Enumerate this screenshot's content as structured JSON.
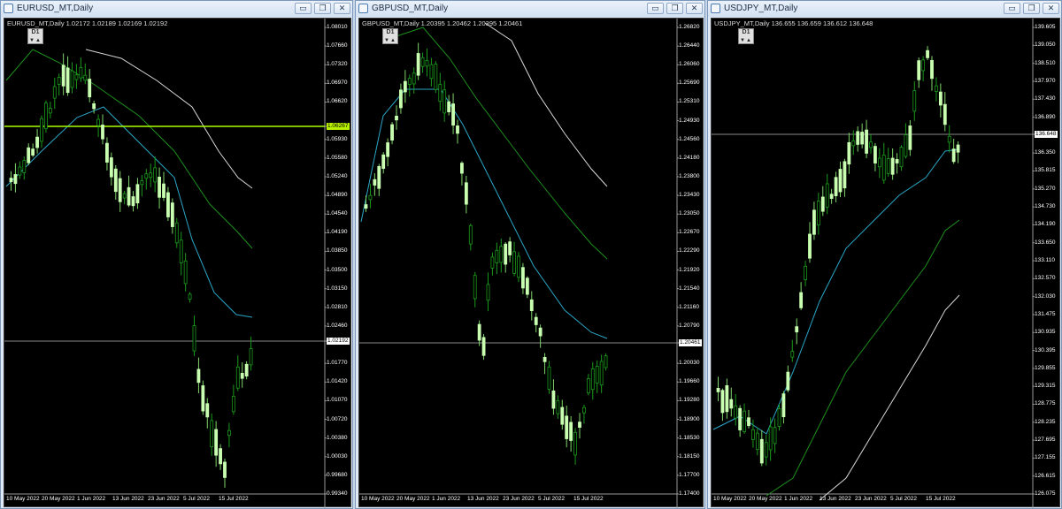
{
  "windows": [
    {
      "title": "EURUSD_MT,Daily",
      "info": "EURUSD_MT,Daily  1.02172 1.02189 1.02169 1.02192",
      "timeframe": "D1",
      "prices": [
        "1.08010",
        "1.07660",
        "1.07320",
        "1.06970",
        "1.06620",
        "1.06267",
        "1.05930",
        "1.05580",
        "1.05240",
        "1.04890",
        "1.04540",
        "1.04190",
        "1.03850",
        "1.03500",
        "1.03150",
        "1.02810",
        "1.02460",
        "1.02192",
        "1.01770",
        "1.01420",
        "1.01070",
        "1.00720",
        "1.00380",
        "1.00030",
        "0.99680",
        "0.99340"
      ],
      "current_price": "1.02192",
      "hline_price": "1.06267",
      "dates": [
        "10 May 2022",
        "20 May 2022",
        "1 Jun 2022",
        "13 Jun 2022",
        "23 Jun 2022",
        "5 Jul 2022",
        "15 Jul 2022"
      ]
    },
    {
      "title": "GBPUSD_MT,Daily",
      "info": "GBPUSD_MT,Daily  1.20395 1.20462 1.20395 1.20461",
      "timeframe": "D1",
      "prices": [
        "1.26820",
        "1.26440",
        "1.26060",
        "1.25690",
        "1.25310",
        "1.24930",
        "1.24560",
        "1.24180",
        "1.23800",
        "1.23430",
        "1.23050",
        "1.22670",
        "1.22290",
        "1.21920",
        "1.21540",
        "1.21160",
        "1.20790",
        "1.20461",
        "1.20030",
        "1.19660",
        "1.19280",
        "1.18900",
        "1.18530",
        "1.18150",
        "1.17700",
        "1.17400"
      ],
      "current_price": "1.20461",
      "dates": [
        "10 May 2022",
        "20 May 2022",
        "1 Jun 2022",
        "13 Jun 2022",
        "23 Jun 2022",
        "5 Jul 2022",
        "15 Jul 2022"
      ]
    },
    {
      "title": "USDJPY_MT,Daily",
      "info": "USDJPY_MT,Daily  136.655 136.659 136.612 136.648",
      "timeframe": "D1",
      "prices": [
        "139.605",
        "139.050",
        "138.510",
        "137.970",
        "137.430",
        "136.890",
        "136.648",
        "136.350",
        "135.815",
        "135.270",
        "134.730",
        "134.190",
        "133.650",
        "133.110",
        "132.570",
        "132.030",
        "131.475",
        "130.935",
        "130.395",
        "129.855",
        "129.315",
        "128.775",
        "128.235",
        "127.695",
        "127.155",
        "126.615",
        "126.075"
      ],
      "current_price": "136.648",
      "dates": [
        "10 May 2022",
        "20 May 2022",
        "1 Jun 2022",
        "13 Jun 2022",
        "23 Jun 2022",
        "5 Jul 2022",
        "15 Jul 2022"
      ]
    }
  ],
  "colors": {
    "bull": "#c9ffb0",
    "bear": "#1a9a1a",
    "ma_fast": "#2aa6c6",
    "ma_mid": "#1c8f1c",
    "ma_slow": "#d8d8d8",
    "hline": "#a8ff00"
  },
  "icons": {
    "app": "chart-window-icon",
    "minimize": "minimize-icon",
    "maximize": "maximize-icon",
    "close": "close-icon"
  }
}
